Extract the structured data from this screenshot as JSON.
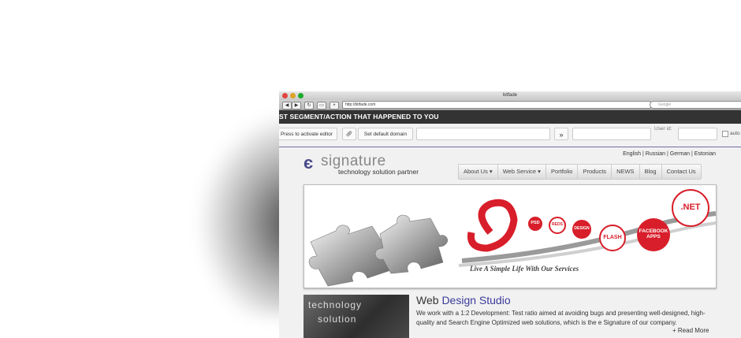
{
  "window": {
    "title": "bitfade",
    "url": "http://bitfade.com",
    "search_placeholder": "Google"
  },
  "segment_bar": {
    "text": "ST SEGMENT/ACTION THAT HAPPENED TO YOU"
  },
  "editor_bar": {
    "activate_label": "Press to activate editor",
    "default_domain_label": "Set default domain",
    "go_glyph": "»",
    "user_id_label": "User id:",
    "auto_label": "auto"
  },
  "site": {
    "languages": "English | Russian | German | Estonian",
    "logo": {
      "name": "signature",
      "tagline": "technology solution partner"
    },
    "menu": [
      "About Us ▾",
      "Web Service ▾",
      "Portfolio",
      "Products",
      "NEWS",
      "Blog",
      "Contact Us"
    ],
    "banner": {
      "slogan": "Live A Simple Life With Our Services",
      "bubbles": [
        "PSD",
        "REDS",
        "DESIGN",
        "FLASH",
        "FACEBOOK APPS",
        ".NET"
      ]
    },
    "thumb_words": [
      "technology",
      "solution"
    ],
    "section": {
      "title_plain": "Web ",
      "title_accent": "Design Studio",
      "text": "We work with a 1:2 Development: Test ratio aimed at avoiding bugs and presenting well-designed, high-quality and Search Engine Optimized web solutions, which is the e Signature of our company.",
      "read_more": "+ Read More"
    }
  },
  "colors": {
    "accent_red": "#d81e2a",
    "logo_blue": "#4a4a8a",
    "title_blue": "#3a3a9a"
  }
}
